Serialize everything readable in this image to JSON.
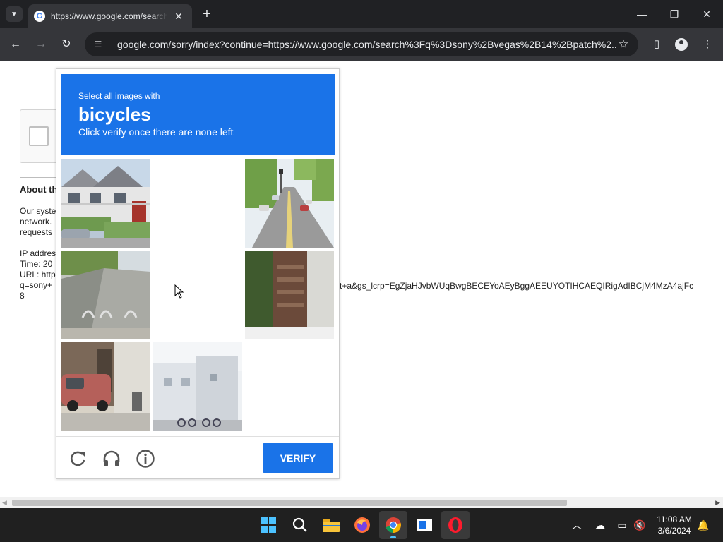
{
  "browser": {
    "tab_title": "https://www.google.com/search?q=sony+vegas",
    "tab_favicon": "G",
    "tab_close": "✕",
    "new_tab": "+",
    "url": "google.com/sorry/index?continue=https://www.google.com/search%3Fq%3Dsony%2Bvegas%2B14%2Bpatch%2...",
    "icons": [
      "tab-search-icon",
      "back-icon",
      "forward-icon",
      "reload-icon",
      "site-info-icon",
      "bookmark-star-icon",
      "side-panel-icon",
      "profile-icon",
      "menu-icon",
      "minimize-icon",
      "restore-icon",
      "close-icon"
    ]
  },
  "page": {
    "about_heading": "About th",
    "lines_block1": [
      "Our syste",
      "network.",
      "requests"
    ],
    "lines_block2": [
      "IP addres",
      "Time: 20",
      "URL: http",
      "q=sony+",
      "8"
    ],
    "url_tail": "t+a&gs_lcrp=EgZjaHJvbWUqBwgBECEYoAEyBggAEEUYOTIHCAEQIRigAdIBCjM4MzA4ajFc"
  },
  "captcha": {
    "instruction_line1": "Select all images with",
    "target_object": "bicycles",
    "instruction_line2": "Click verify once there are none left",
    "verify_label": "VERIFY",
    "footer_icons": [
      "reload-challenge-icon",
      "audio-challenge-icon",
      "info-icon"
    ],
    "tiles": [
      {
        "row": 1,
        "col": 1,
        "state": "image",
        "subject": "houses with porches and parked car"
      },
      {
        "row": 1,
        "col": 2,
        "state": "blank"
      },
      {
        "row": 1,
        "col": 3,
        "state": "image",
        "subject": "tree-lined street with cars"
      },
      {
        "row": 2,
        "col": 1,
        "state": "image",
        "subject": "sloped path with bike racks"
      },
      {
        "row": 2,
        "col": 2,
        "state": "blank"
      },
      {
        "row": 2,
        "col": 3,
        "state": "image",
        "subject": "narrow alley with stairs"
      },
      {
        "row": 3,
        "col": 1,
        "state": "image",
        "subject": "red car parked by building"
      },
      {
        "row": 3,
        "col": 2,
        "state": "image",
        "subject": "white building with bicycles"
      },
      {
        "row": 3,
        "col": 3,
        "state": "blank"
      }
    ],
    "accent_color": "#1a73e8"
  },
  "taskbar": {
    "apps": [
      "start-icon",
      "search-icon",
      "file-explorer-icon",
      "firefox-icon",
      "chrome-icon",
      "app-window-icon",
      "opera-icon"
    ],
    "tray_icons": [
      "chevron-up-icon",
      "onedrive-icon",
      "network-icon",
      "volume-muted-icon",
      "notification-bell-icon"
    ],
    "time": "11:08 AM",
    "date": "3/6/2024"
  }
}
